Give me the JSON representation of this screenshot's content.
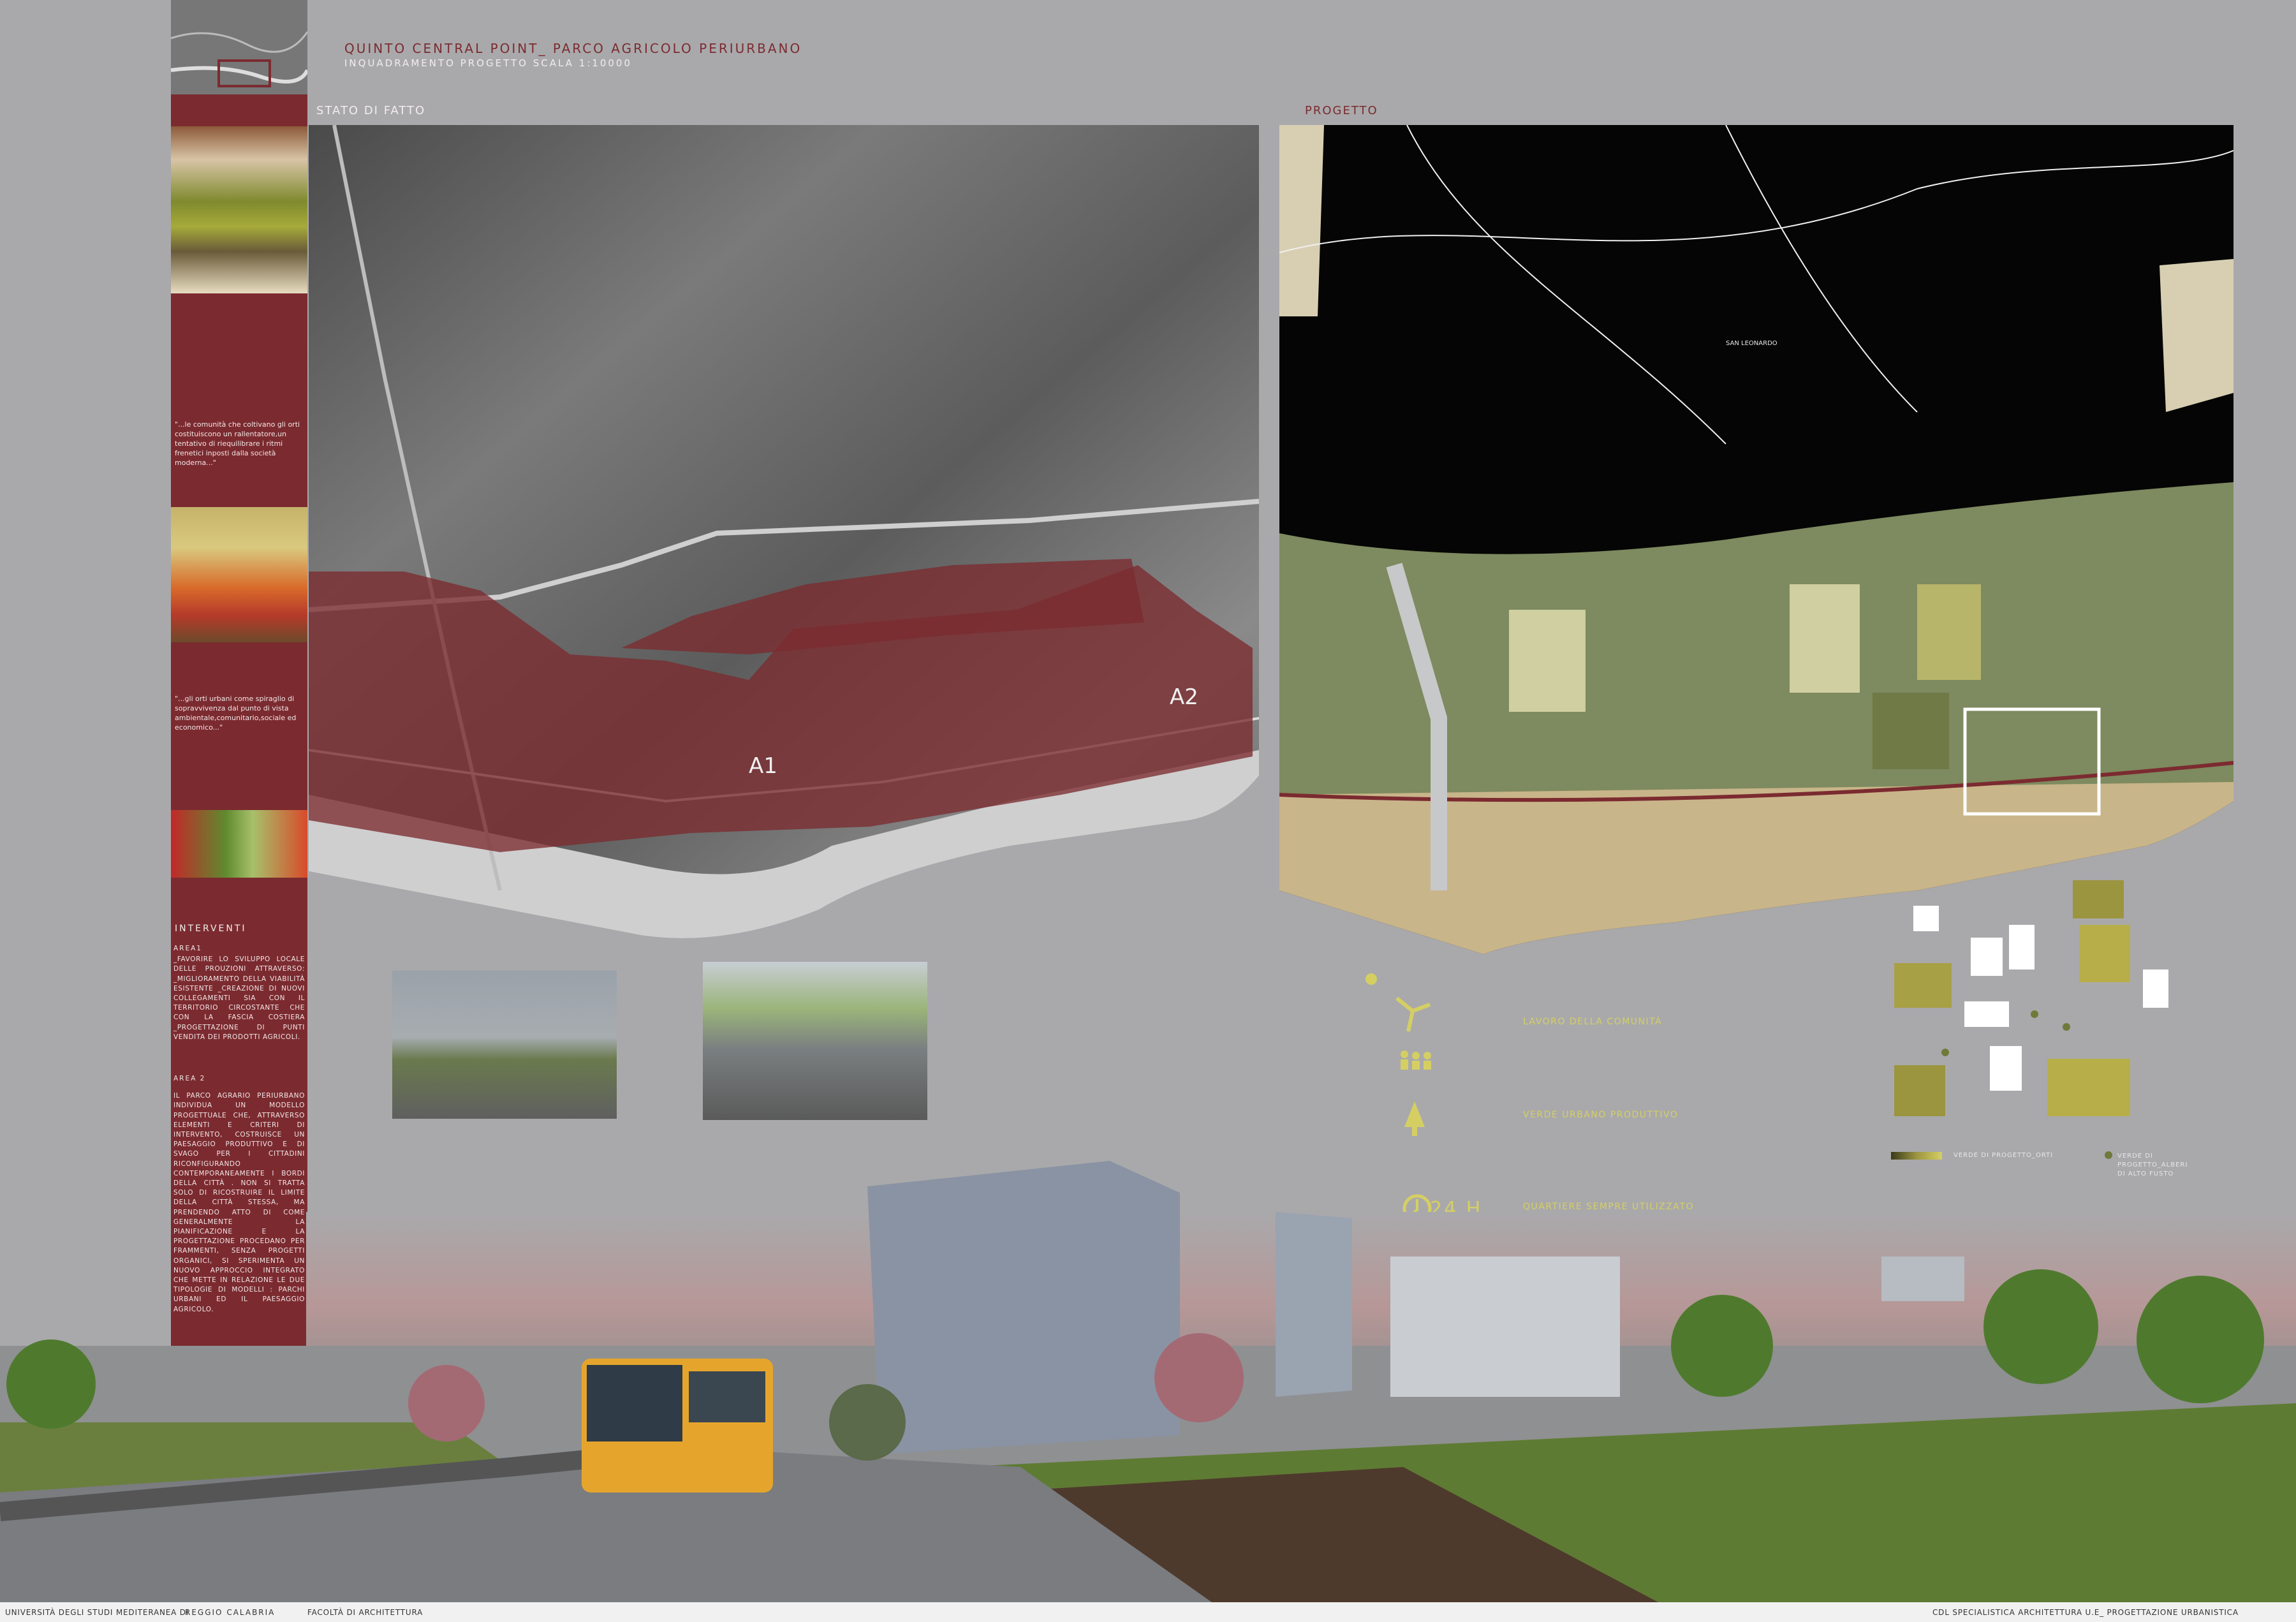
{
  "header": {
    "title": "QUINTO CENTRAL POINT_ PARCO AGRICOLO PERIURBANO",
    "subtitle": "INQUADRAMENTO PROGETTO SCALA 1:10000"
  },
  "panels": {
    "left_label": "STATO DI FATTO",
    "right_label": "PROGETTO",
    "area_labels": [
      "A1",
      "A2"
    ],
    "street_label": "SAN LEONARDO"
  },
  "sidebar": {
    "quote1": "\"...le comunità che coltivano gli orti costituiscono un rallentatore,un tentativo di riequilibrare i ritmi frenetici inposti dalla società moderna...\"",
    "quote2": "\"...gli orti urbani come spiraglio di sopravvivenza dal punto di vista ambientale,comunitario,sociale ed economico...\"",
    "interventi_title": "INTERVENTI",
    "area1_title": "AREA1",
    "area1_text": "_FAVORIRE LO SVILUPPO LOCALE DELLE PROUZIONI ATTRAVERSO: _MIGLIORAMENTO DELLA VIABILITÀ ESISTENTE _CREAZIONE DI NUOVI COLLEGAMENTI SIA CON IL TERRITORIO CIRCOSTANTE CHE CON LA FASCIA COSTIERA _PROGETTAZIONE DI PUNTI VENDITA DEI PRODOTTI AGRICOLI.",
    "area2_title": "AREA 2",
    "area2_text": "IL PARCO AGRARIO PERIURBANO INDIVIDUA UN MODELLO PROGETTUALE CHE, ATTRAVERSO ELEMENTI E CRITERI DI INTERVENTO, COSTRUISCE UN PAESAGGIO PRODUTTIVO E DI SVAGO PER I CITTADINI RICONFIGURANDO CONTEMPORANEAMENTE I BORDI DELLA CITTÀ . NON SI TRATTA SOLO DI RICOSTRUIRE IL LIMITE DELLA CITTÀ STESSA, MA PRENDENDO ATTO DI COME GENERALMENTE LA PIANIFICAZIONE E LA PROGETTAZIONE PROCEDANO PER FRAMMENTI, SENZA PROGETTI ORGANICI, SI SPERIMENTA UN NUOVO APPROCCIO INTEGRATO CHE METTE IN RELAZIONE LE DUE TIPOLOGIE DI MODELLI : PARCHI URBANI ED IL PAESAGGIO AGRICOLO."
  },
  "legend": {
    "item1": "LAVORO DELLA COMUNITÀ",
    "item2": "VERDE URBANO PRODUTTIVO",
    "item3": "QUARTIERE SEMPRE UTILIZZATO",
    "clock_text": "24 H"
  },
  "plan_legend": {
    "orti": "VERDE DI PROGETTO_ORTI",
    "alberi": "VERDE DI PROGETTO_ALBERI DI ALTO FUSTO"
  },
  "footer": {
    "left_a": "UNIVERSITÀ DEGLI STUDI MEDITERANEA DI",
    "left_b": "REGGIO CALABRIA",
    "left_c": "FACOLTÀ DI ARCHITETTURA",
    "right": "CDL SPECIALISTICA ARCHITETTURA U.E_ PROGETTAZIONE URBANISTICA"
  },
  "colors": {
    "background": "#a9a9ab",
    "accent": "#7b2b30",
    "legend_yellow": "#d5cf63",
    "map_dark": "#050505"
  }
}
